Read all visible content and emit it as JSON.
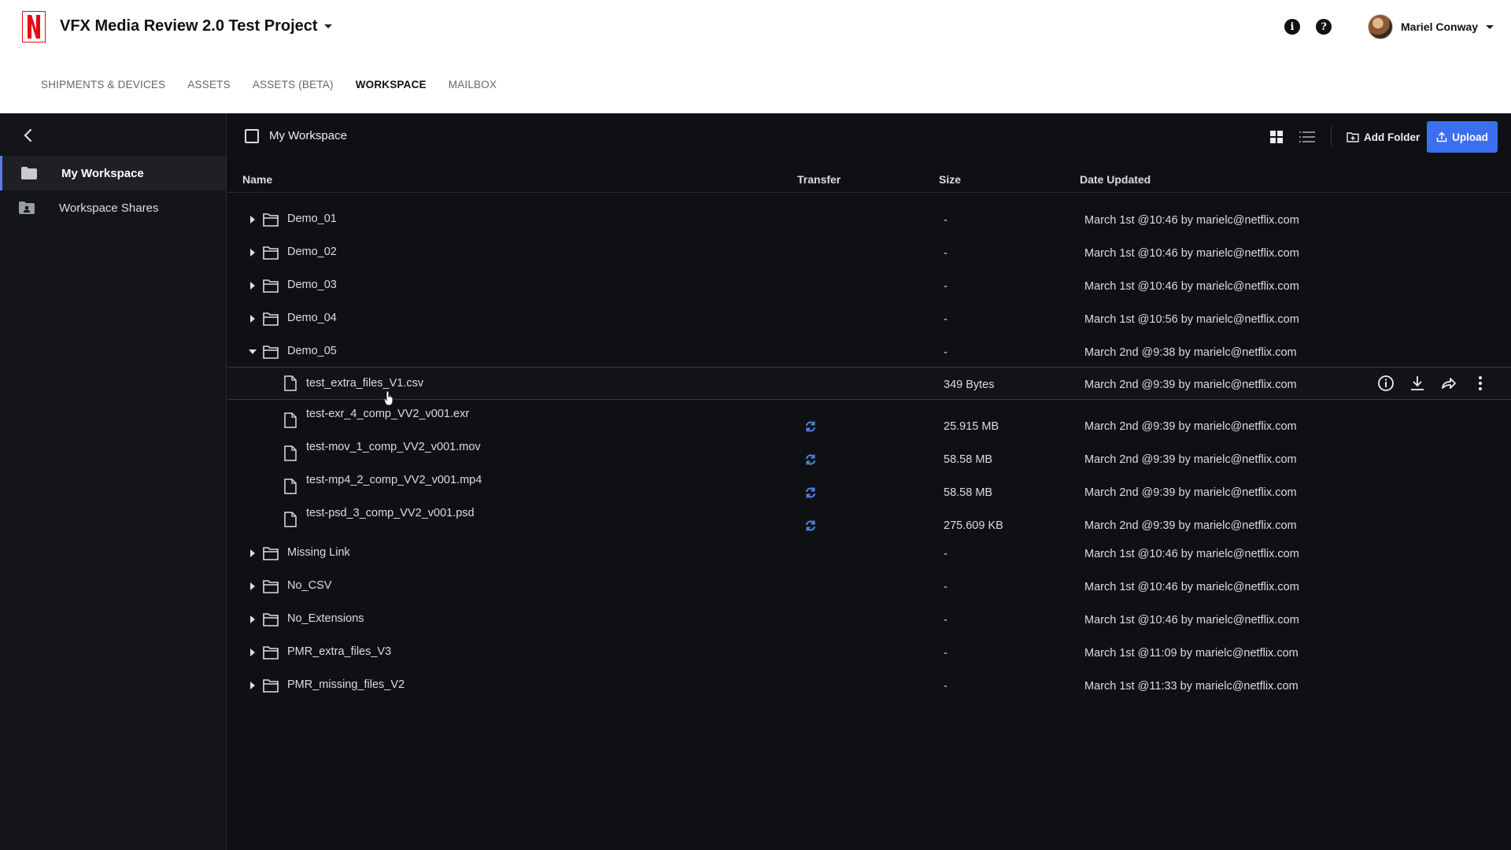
{
  "header": {
    "project_title": "VFX Media Review 2.0 Test Project",
    "user_name": "Mariel Conway",
    "info_icon": "info-icon",
    "help_icon": "help-icon",
    "logo_letter": "N"
  },
  "nav": {
    "items": [
      {
        "label": "SHIPMENTS & DEVICES"
      },
      {
        "label": "ASSETS"
      },
      {
        "label": "ASSETS (BETA)"
      },
      {
        "label": "WORKSPACE",
        "active": true
      },
      {
        "label": "MAILBOX"
      }
    ]
  },
  "sidebar": {
    "items": [
      {
        "label": "My Workspace",
        "icon": "folder-icon",
        "active": true
      },
      {
        "label": "Workspace Shares",
        "icon": "shared-folder-icon"
      }
    ]
  },
  "toolbar": {
    "title": "My Workspace",
    "add_folder_label": "Add Folder",
    "upload_label": "Upload"
  },
  "table": {
    "columns": [
      "Name",
      "Transfer",
      "Size",
      "Date Updated"
    ],
    "rows": [
      {
        "name": "Demo_01",
        "type": "folder",
        "expanded": false,
        "size": "-",
        "date": "March 1st @10:46 by marielc@netflix.com"
      },
      {
        "name": "Demo_02",
        "type": "folder",
        "expanded": false,
        "size": "-",
        "date": "March 1st @10:46 by marielc@netflix.com"
      },
      {
        "name": "Demo_03",
        "type": "folder",
        "expanded": false,
        "size": "-",
        "date": "March 1st @10:46 by marielc@netflix.com"
      },
      {
        "name": "Demo_04",
        "type": "folder",
        "expanded": false,
        "size": "-",
        "date": "March 1st @10:56 by marielc@netflix.com"
      },
      {
        "name": "Demo_05",
        "type": "folder",
        "expanded": true,
        "size": "-",
        "date": "March 2nd @9:38 by marielc@netflix.com"
      },
      {
        "name": "test_extra_files_V1.csv",
        "type": "file",
        "size": "349 Bytes",
        "date": "March 2nd @9:39 by marielc@netflix.com",
        "hover": true
      },
      {
        "name": "test-exr_4_comp_VV2_v001.exr",
        "type": "file",
        "size": "25.915 MB",
        "date": "March 2nd @9:39 by marielc@netflix.com",
        "syncing": true
      },
      {
        "name": "test-mov_1_comp_VV2_v001.mov",
        "type": "file",
        "size": "58.58 MB",
        "date": "March 2nd @9:39 by marielc@netflix.com",
        "syncing": true
      },
      {
        "name": "test-mp4_2_comp_VV2_v001.mp4",
        "type": "file",
        "size": "58.58 MB",
        "date": "March 2nd @9:39 by marielc@netflix.com",
        "syncing": true
      },
      {
        "name": "test-psd_3_comp_VV2_v001.psd",
        "type": "file",
        "size": "275.609 KB",
        "date": "March 2nd @9:39 by marielc@netflix.com",
        "syncing": true
      },
      {
        "name": "Missing Link",
        "type": "folder",
        "expanded": false,
        "size": "-",
        "date": "March 1st @10:46 by marielc@netflix.com"
      },
      {
        "name": "No_CSV",
        "type": "folder",
        "expanded": false,
        "size": "-",
        "date": "March 1st @10:46 by marielc@netflix.com"
      },
      {
        "name": "No_Extensions",
        "type": "folder",
        "expanded": false,
        "size": "-",
        "date": "March 1st @10:46 by marielc@netflix.com"
      },
      {
        "name": "PMR_extra_files_V3",
        "type": "folder",
        "expanded": false,
        "size": "-",
        "date": "March 1st @11:09 by marielc@netflix.com"
      },
      {
        "name": "PMR_missing_files_V2",
        "type": "folder",
        "expanded": false,
        "size": "-",
        "date": "March 1st @11:33 by marielc@netflix.com"
      }
    ],
    "row_actions": [
      "info-icon",
      "download-icon",
      "share-icon",
      "more-vertical-icon"
    ]
  },
  "colors": {
    "accent": "#3b6ff0",
    "sync": "#4a86e8",
    "background": "#0f1014",
    "sidebar": "#141519",
    "header": "#ffffff",
    "logo": "#e50914"
  }
}
